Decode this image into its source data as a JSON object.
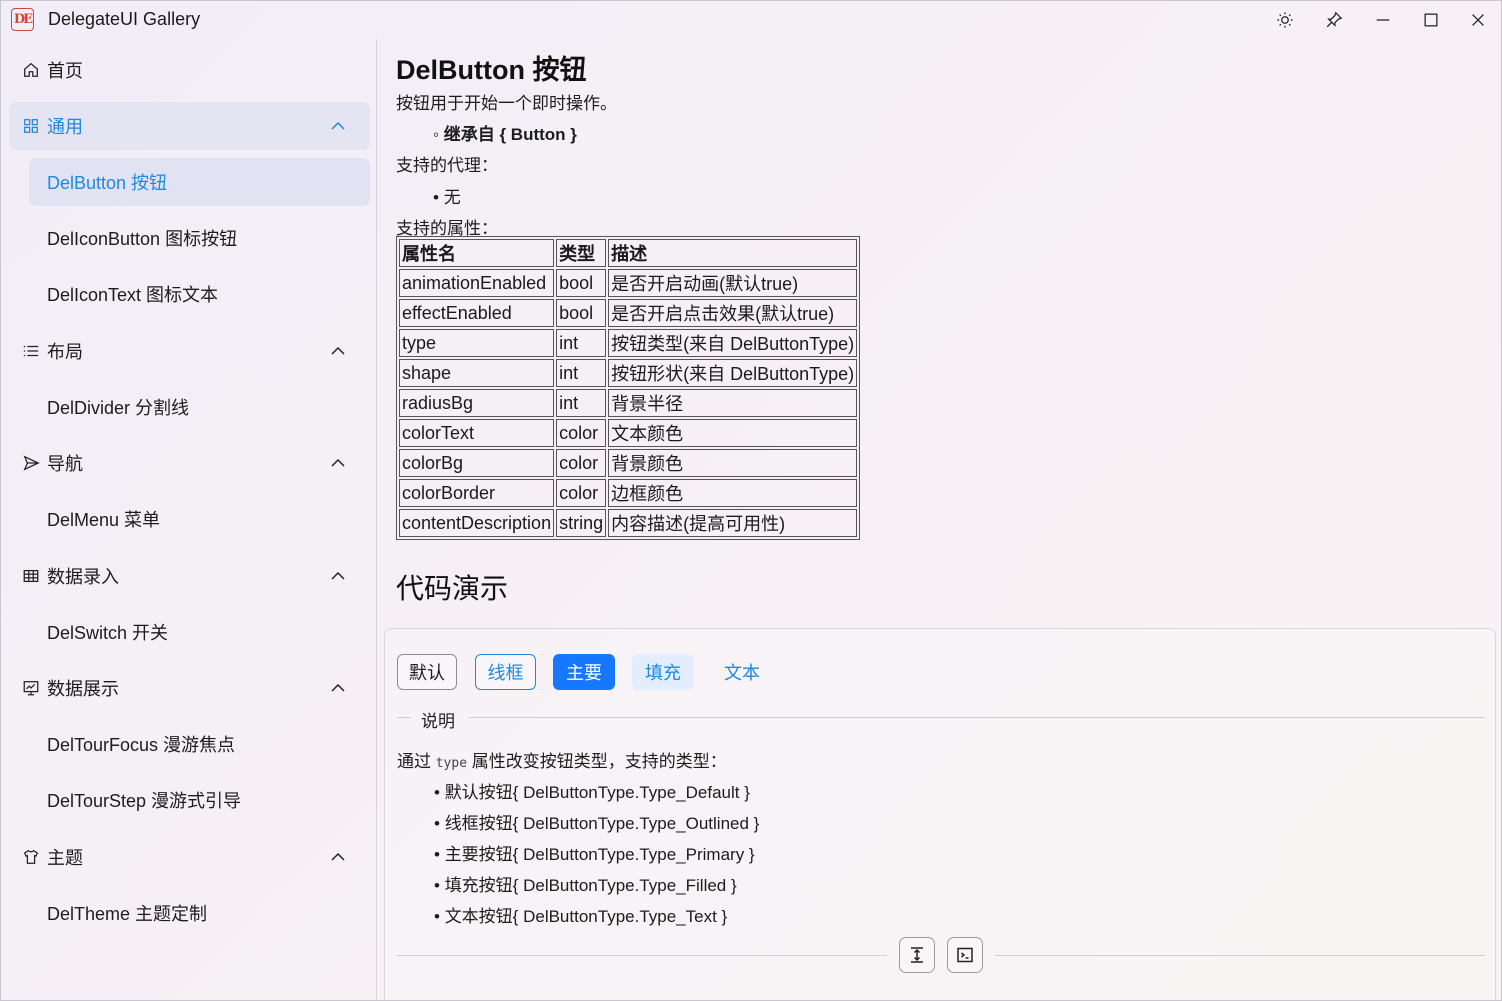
{
  "window": {
    "title": "DelegateUI Gallery",
    "app_icon_text": "DE",
    "controls": [
      "theme-toggle",
      "pin",
      "minimize",
      "maximize",
      "close"
    ]
  },
  "sidebar": {
    "items": [
      {
        "label": "首页",
        "icon": "home-icon",
        "type": "item"
      },
      {
        "label": "通用",
        "icon": "apps-icon",
        "type": "group",
        "expanded": true,
        "active": true
      },
      {
        "label": "DelButton 按钮",
        "type": "sub",
        "selected": true
      },
      {
        "label": "DelIconButton 图标按钮",
        "type": "sub"
      },
      {
        "label": "DelIconText 图标文本",
        "type": "sub"
      },
      {
        "label": "布局",
        "icon": "list-icon",
        "type": "group",
        "expanded": true
      },
      {
        "label": "DelDivider 分割线",
        "type": "sub"
      },
      {
        "label": "导航",
        "icon": "send-icon",
        "type": "group",
        "expanded": true
      },
      {
        "label": "DelMenu 菜单",
        "type": "sub"
      },
      {
        "label": "数据录入",
        "icon": "table-icon",
        "type": "group",
        "expanded": true
      },
      {
        "label": "DelSwitch 开关",
        "type": "sub"
      },
      {
        "label": "数据展示",
        "icon": "presentation-icon",
        "type": "group",
        "expanded": true
      },
      {
        "label": "DelTourFocus 漫游焦点",
        "type": "sub"
      },
      {
        "label": "DelTourStep 漫游式引导",
        "type": "sub"
      },
      {
        "label": "主题",
        "icon": "shirt-icon",
        "type": "group",
        "expanded": true
      },
      {
        "label": "DelTheme 主题定制",
        "type": "sub"
      }
    ]
  },
  "main": {
    "title": "DelButton 按钮",
    "intro": "按钮用于开始一个即时操作。",
    "inherits": "继承自 { Button }",
    "delegates_heading": "支持的代理：",
    "delegates_item": "无",
    "properties_heading": "支持的属性：",
    "table": {
      "headers": [
        "属性名",
        "类型",
        "描述"
      ],
      "rows": [
        [
          "animationEnabled",
          "bool",
          "是否开启动画(默认true)"
        ],
        [
          "effectEnabled",
          "bool",
          "是否开启点击效果(默认true)"
        ],
        [
          "type",
          "int",
          "按钮类型(来自 DelButtonType)"
        ],
        [
          "shape",
          "int",
          "按钮形状(来自 DelButtonType)"
        ],
        [
          "radiusBg",
          "int",
          "背景半径"
        ],
        [
          "colorText",
          "color",
          "文本颜色"
        ],
        [
          "colorBg",
          "color",
          "背景颜色"
        ],
        [
          "colorBorder",
          "color",
          "边框颜色"
        ],
        [
          "contentDescription",
          "string",
          "内容描述(提高可用性)"
        ]
      ]
    },
    "demo_heading": "代码演示",
    "demo": {
      "buttons": [
        "默认",
        "线框",
        "主要",
        "填充",
        "文本"
      ],
      "divider_label": "说明",
      "desc_prefix": "通过",
      "desc_code": "type",
      "desc_suffix": "属性改变按钮类型，支持的类型：",
      "types": [
        "默认按钮{ DelButtonType.Type_Default }",
        "线框按钮{ DelButtonType.Type_Outlined }",
        "主要按钮{ DelButtonType.Type_Primary }",
        "填充按钮{ DelButtonType.Type_Filled }",
        "文本按钮{ DelButtonType.Type_Text }"
      ]
    }
  },
  "colors": {
    "accent": "#1e88e5",
    "primary_button": "#1677ff",
    "app_icon": "#d0463d"
  }
}
